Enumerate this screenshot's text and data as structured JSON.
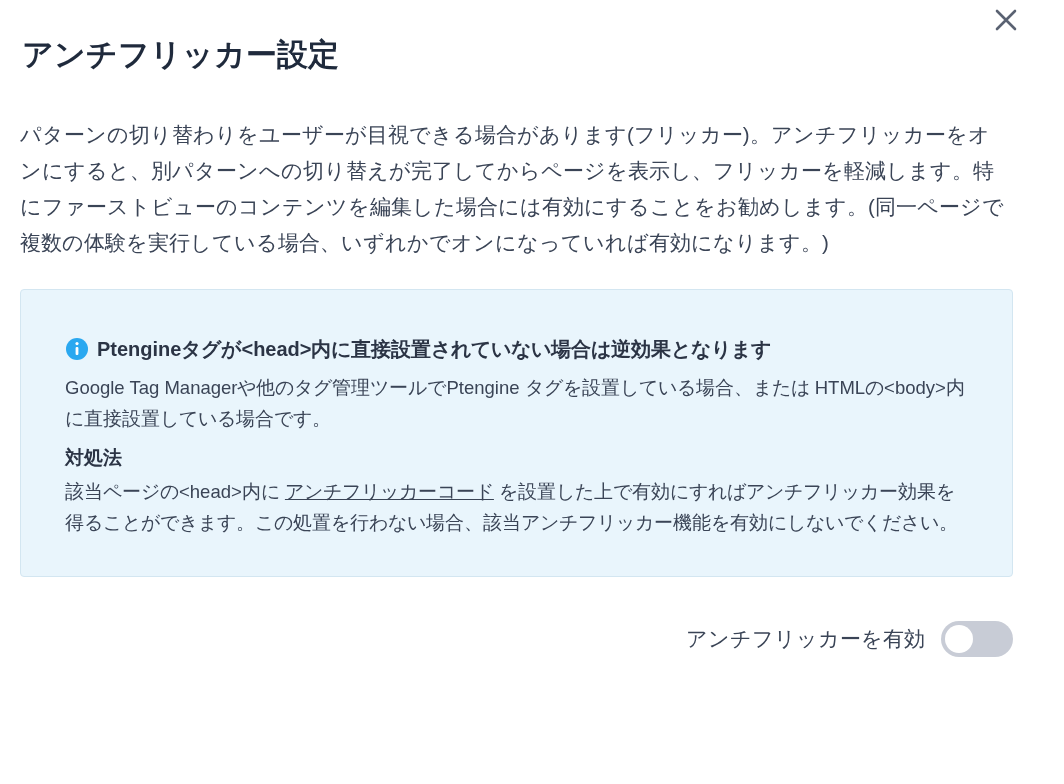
{
  "dialog": {
    "title": "アンチフリッカー設定",
    "description": "パターンの切り替わりをユーザーが目視できる場合があります(フリッカー)。アンチフリッカーをオンにすると、別パターンへの切り替えが完了してからページを表示し、フリッカーを軽減します。特にファーストビューのコンテンツを編集した場合には有効にすることをお勧めします。(同一ページで複数の体験を実行している場合、いずれかでオンになっていれば有効になります。)",
    "notice": {
      "heading": "Ptengineタグが<head>内に直接設置されていない場合は逆効果となります",
      "body": "Google Tag Managerや他のタグ管理ツールでPtengine タグを設置している場合、または HTMLの<body>内に直接設置している場合です。",
      "subheading": "対処法",
      "remedy_before": "該当ページの<head>内に ",
      "remedy_link": "アンチフリッカーコード",
      "remedy_after": " を設置した上で有効にすればアンチフリッカー効果を得ることができます。この処置を行わない場合、該当アンチフリッカー機能を有効にしないでください。"
    },
    "toggle": {
      "label": "アンチフリッカーを有効",
      "on": false
    }
  }
}
